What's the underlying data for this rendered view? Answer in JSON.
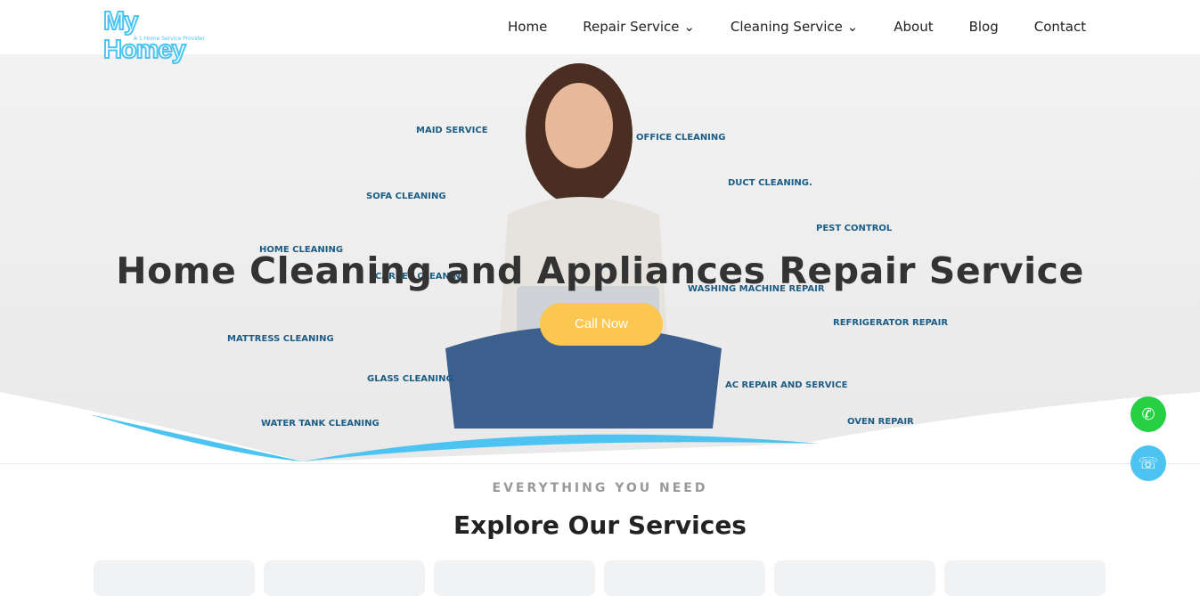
{
  "brand": {
    "name": "My Homey",
    "tagline": "A 1 Home Service Provider",
    "color": "#4cc3f1"
  },
  "nav": {
    "items": [
      {
        "label": "Home"
      },
      {
        "label": "Repair Service",
        "dropdown": true
      },
      {
        "label": "Cleaning Service",
        "dropdown": true
      },
      {
        "label": "About"
      },
      {
        "label": "Blog"
      },
      {
        "label": "Contact"
      }
    ]
  },
  "hero": {
    "title": "Home Cleaning and Appliances Repair Service",
    "cta": "Call Now",
    "cta_color": "#fcc751",
    "services": [
      "MAID SERVICE",
      "OFFICE CLEANING",
      "SOFA CLEANING",
      "DUCT CLEANING.",
      "HOME CLEANING",
      "PEST CONTROL",
      "CARPET CLEANING",
      "WASHING MACHINE REPAIR",
      "REFRIGERATOR REPAIR",
      "MATTRESS CLEANING",
      "GLASS CLEANING",
      "AC REPAIR AND SERVICE",
      "WATER TANK CLEANING",
      "OVEN REPAIR"
    ]
  },
  "floating": {
    "whatsapp_color": "#25d042",
    "phone_color": "#4cc3f1"
  },
  "section": {
    "eyebrow": "EVERYTHING YOU NEED",
    "title": "Explore Our Services"
  }
}
